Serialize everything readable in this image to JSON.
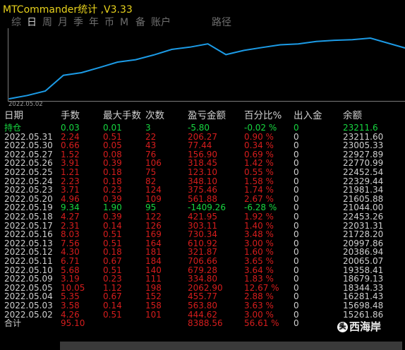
{
  "window": {
    "title": "MTCommander统计 ,V3.33"
  },
  "tabs": [
    {
      "label": "综",
      "active": false
    },
    {
      "label": "日",
      "active": true
    },
    {
      "label": "周",
      "active": false
    },
    {
      "label": "月",
      "active": false
    },
    {
      "label": "季",
      "active": false
    },
    {
      "label": "年",
      "active": false
    },
    {
      "label": "币",
      "active": false
    },
    {
      "label": "M",
      "active": false
    },
    {
      "label": "备",
      "active": false
    },
    {
      "label": "账户",
      "active": false
    },
    {
      "label": "路径",
      "active": false
    }
  ],
  "chart_data": {
    "type": "line",
    "x_start_label": "2022.05.02",
    "x": [
      "2022.05.02",
      "2022.05.03",
      "2022.05.04",
      "2022.05.05",
      "2022.05.09",
      "2022.05.10",
      "2022.05.11",
      "2022.05.12",
      "2022.05.13",
      "2022.05.16",
      "2022.05.17",
      "2022.05.18",
      "2022.05.19",
      "2022.05.20",
      "2022.05.23",
      "2022.05.24",
      "2022.05.25",
      "2022.05.26",
      "2022.05.27",
      "2022.05.30",
      "2022.05.31"
    ],
    "values": [
      15261.86,
      15698.48,
      16281.43,
      18344.33,
      18679.13,
      19358.41,
      20065.07,
      20386.94,
      20997.86,
      21728.2,
      22031.31,
      22453.26,
      21044.0,
      21605.88,
      21981.34,
      22329.44,
      22452.54,
      22770.99,
      22927.89,
      23005.33,
      23211.6
    ],
    "line_color": "#1c9be6"
  },
  "table": {
    "headers": [
      "日期",
      "手数",
      "最大手数",
      "次数",
      "盈亏金额",
      "百分比%",
      "出入金",
      "余额"
    ],
    "position_row": {
      "date": "持仓",
      "lots": "0.03",
      "max_lots": "0.01",
      "count": "3",
      "pnl": "-5.80",
      "pct": "-0.02 %",
      "flow": "0",
      "balance": "23211.6"
    },
    "rows": [
      {
        "date": "2022.05.31",
        "lots": "2.24",
        "max_lots": "0.51",
        "count": "22",
        "pnl": "206.27",
        "pct": "0.90 %",
        "flow": "0",
        "balance": "23211.60",
        "neg": false
      },
      {
        "date": "2022.05.30",
        "lots": "0.66",
        "max_lots": "0.05",
        "count": "43",
        "pnl": "77.44",
        "pct": "0.34 %",
        "flow": "0",
        "balance": "23005.33",
        "neg": false
      },
      {
        "date": "2022.05.27",
        "lots": "1.52",
        "max_lots": "0.08",
        "count": "76",
        "pnl": "156.90",
        "pct": "0.69 %",
        "flow": "0",
        "balance": "22927.89",
        "neg": false
      },
      {
        "date": "2022.05.26",
        "lots": "3.91",
        "max_lots": "0.39",
        "count": "106",
        "pnl": "318.45",
        "pct": "1.42 %",
        "flow": "0",
        "balance": "22770.99",
        "neg": false
      },
      {
        "date": "2022.05.25",
        "lots": "1.21",
        "max_lots": "0.18",
        "count": "75",
        "pnl": "123.10",
        "pct": "0.55 %",
        "flow": "0",
        "balance": "22452.54",
        "neg": false
      },
      {
        "date": "2022.05.24",
        "lots": "2.23",
        "max_lots": "0.18",
        "count": "82",
        "pnl": "348.10",
        "pct": "1.58 %",
        "flow": "0",
        "balance": "22329.44",
        "neg": false
      },
      {
        "date": "2022.05.23",
        "lots": "3.71",
        "max_lots": "0.23",
        "count": "124",
        "pnl": "375.46",
        "pct": "1.74 %",
        "flow": "0",
        "balance": "21981.34",
        "neg": false
      },
      {
        "date": "2022.05.20",
        "lots": "4.96",
        "max_lots": "0.39",
        "count": "109",
        "pnl": "561.88",
        "pct": "2.67 %",
        "flow": "0",
        "balance": "21605.88",
        "neg": false
      },
      {
        "date": "2022.05.19",
        "lots": "9.34",
        "max_lots": "1.90",
        "count": "95",
        "pnl": "-1409.26",
        "pct": "-6.28 %",
        "flow": "0",
        "balance": "21044.00",
        "neg": true
      },
      {
        "date": "2022.05.18",
        "lots": "4.27",
        "max_lots": "0.39",
        "count": "122",
        "pnl": "421.95",
        "pct": "1.92 %",
        "flow": "0",
        "balance": "22453.26",
        "neg": false
      },
      {
        "date": "2022.05.17",
        "lots": "2.31",
        "max_lots": "0.14",
        "count": "126",
        "pnl": "303.11",
        "pct": "1.40 %",
        "flow": "0",
        "balance": "22031.31",
        "neg": false
      },
      {
        "date": "2022.05.16",
        "lots": "8.03",
        "max_lots": "0.51",
        "count": "169",
        "pnl": "730.34",
        "pct": "3.48 %",
        "flow": "0",
        "balance": "21728.20",
        "neg": false
      },
      {
        "date": "2022.05.13",
        "lots": "7.56",
        "max_lots": "0.51",
        "count": "164",
        "pnl": "610.92",
        "pct": "3.00 %",
        "flow": "0",
        "balance": "20997.86",
        "neg": false
      },
      {
        "date": "2022.05.12",
        "lots": "4.30",
        "max_lots": "0.18",
        "count": "181",
        "pnl": "321.87",
        "pct": "1.60 %",
        "flow": "0",
        "balance": "20386.94",
        "neg": false
      },
      {
        "date": "2022.05.11",
        "lots": "6.71",
        "max_lots": "0.67",
        "count": "184",
        "pnl": "706.66",
        "pct": "3.65 %",
        "flow": "0",
        "balance": "20065.07",
        "neg": false
      },
      {
        "date": "2022.05.10",
        "lots": "5.68",
        "max_lots": "0.51",
        "count": "140",
        "pnl": "679.28",
        "pct": "3.64 %",
        "flow": "0",
        "balance": "19358.41",
        "neg": false
      },
      {
        "date": "2022.05.09",
        "lots": "3.19",
        "max_lots": "0.23",
        "count": "111",
        "pnl": "334.80",
        "pct": "1.83 %",
        "flow": "0",
        "balance": "18679.13",
        "neg": false
      },
      {
        "date": "2022.05.05",
        "lots": "10.05",
        "max_lots": "1.12",
        "count": "198",
        "pnl": "2062.90",
        "pct": "12.67 %",
        "flow": "0",
        "balance": "18344.33",
        "neg": false
      },
      {
        "date": "2022.05.04",
        "lots": "5.35",
        "max_lots": "0.67",
        "count": "152",
        "pnl": "455.77",
        "pct": "2.88 %",
        "flow": "0",
        "balance": "16281.43",
        "neg": false
      },
      {
        "date": "2022.05.03",
        "lots": "3.58",
        "max_lots": "0.14",
        "count": "158",
        "pnl": "563.80",
        "pct": "3.63 %",
        "flow": "0",
        "balance": "15698.48",
        "neg": false
      },
      {
        "date": "2022.05.02",
        "lots": "4.26",
        "max_lots": "0.51",
        "count": "101",
        "pnl": "444.62",
        "pct": "3.00 %",
        "flow": "0",
        "balance": "15261.86",
        "neg": false
      }
    ],
    "total_row": {
      "date": "合计",
      "lots": "95.10",
      "pnl": "8388.56",
      "pct": "56.61 %",
      "flow": "0"
    }
  },
  "watermark": {
    "text": "西海岸",
    "logo": "头"
  }
}
